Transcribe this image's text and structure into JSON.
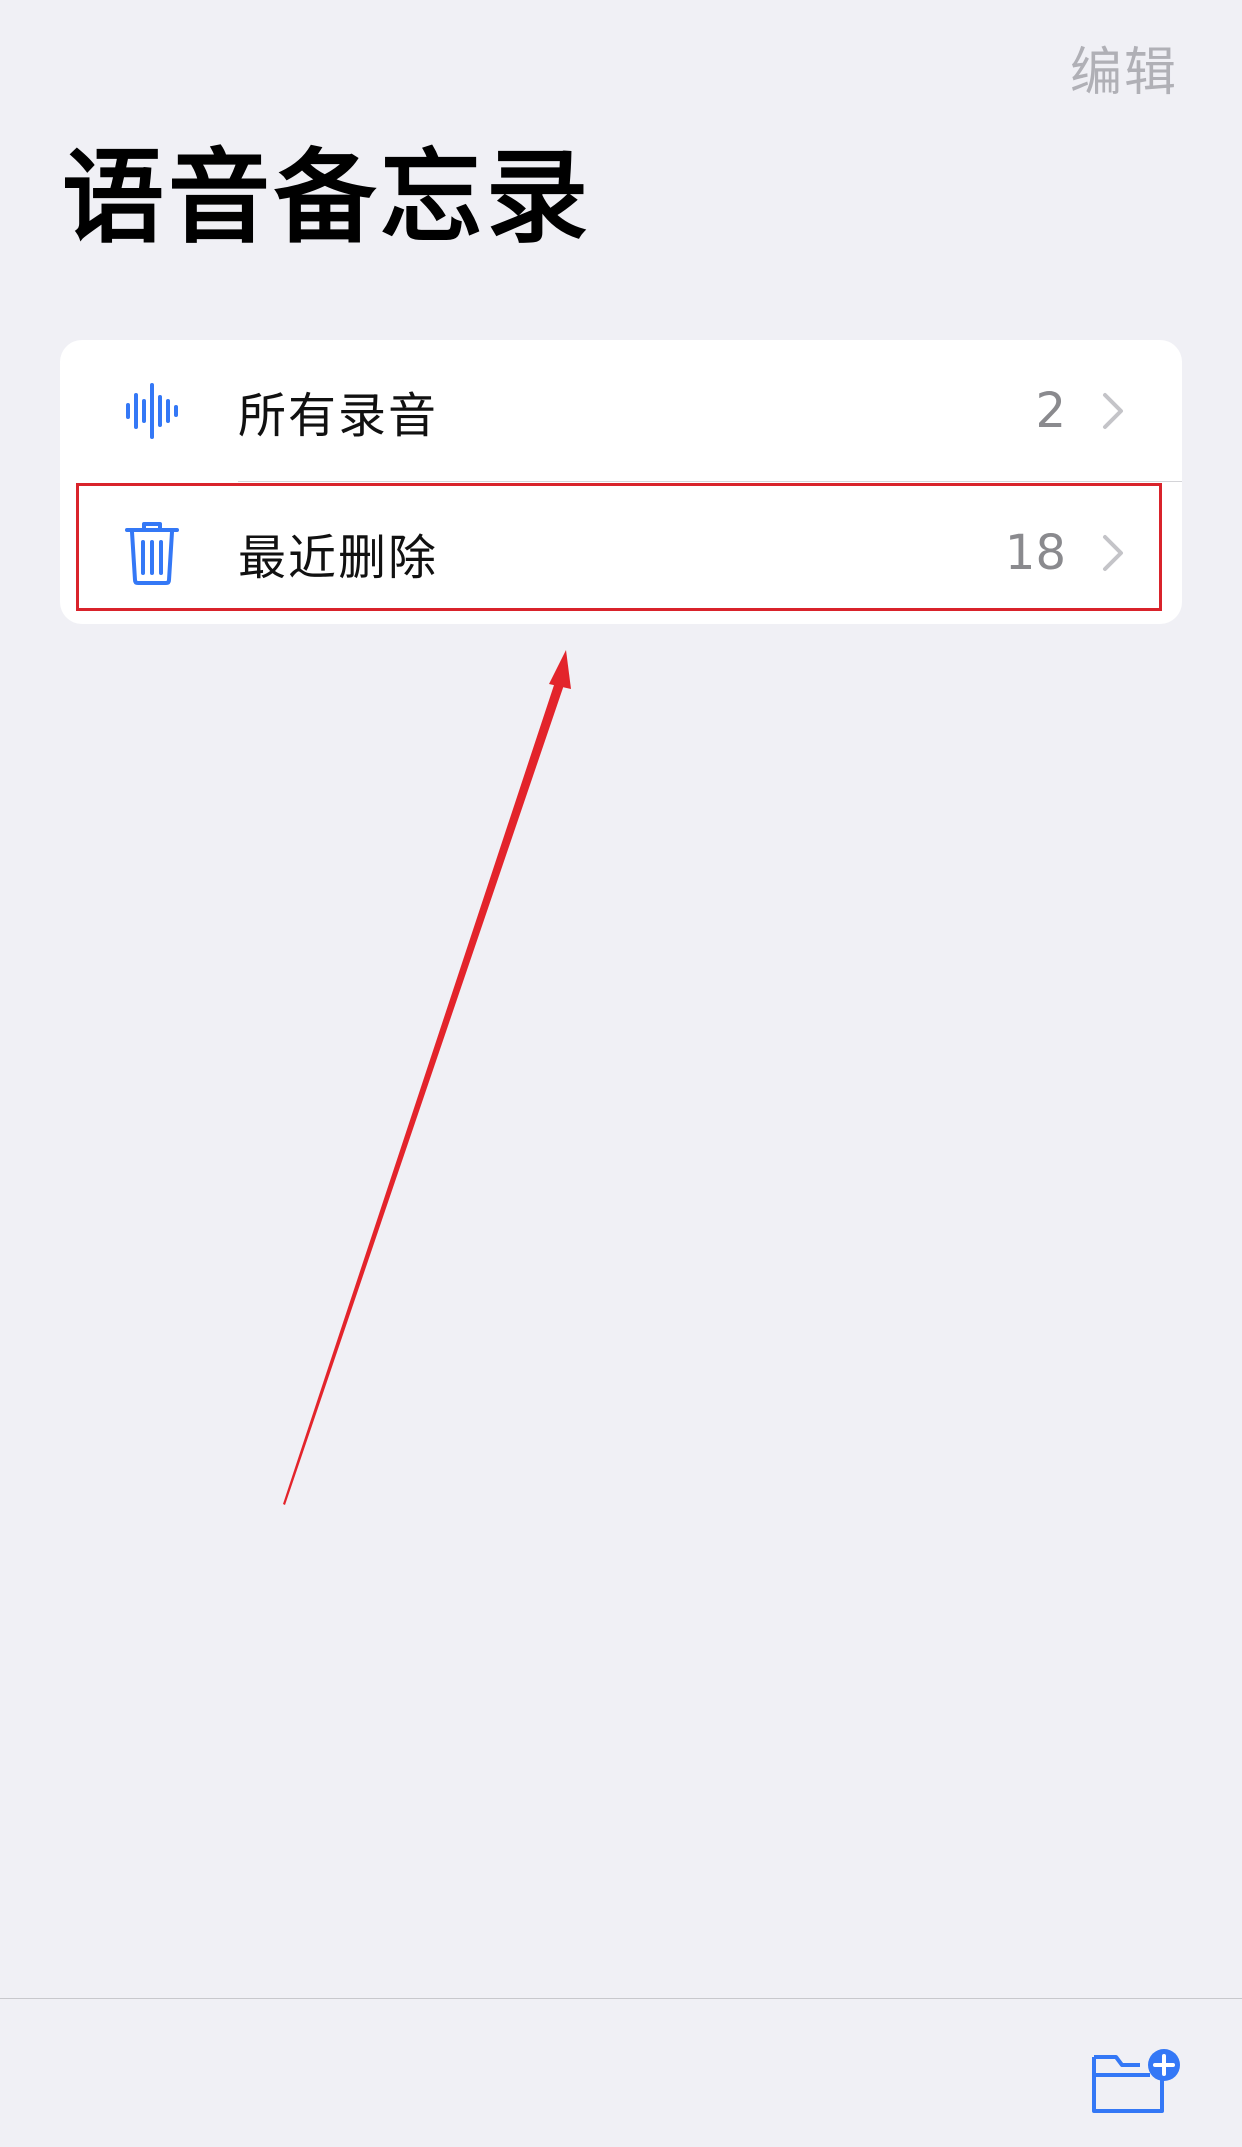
{
  "header": {
    "edit_label": "编辑",
    "title": "语音备忘录"
  },
  "list": {
    "items": [
      {
        "label": "所有录音",
        "count": "2",
        "icon": "waveform-icon"
      },
      {
        "label": "最近删除",
        "count": "18",
        "icon": "trash-icon"
      }
    ]
  },
  "toolbar": {
    "new_folder_icon": "new-folder-icon"
  },
  "colors": {
    "accent": "#3478f6",
    "background": "#f0f0f5",
    "annotation": "#d9232b",
    "secondary_text": "#8a8a8e"
  }
}
